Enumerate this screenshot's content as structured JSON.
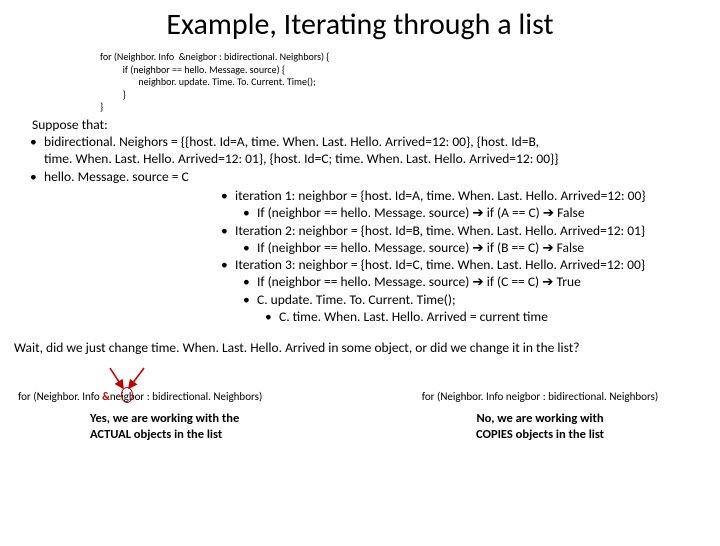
{
  "title": "Example, Iterating through a list",
  "code": {
    "l1": "for (Neighbor. Info  &neigbor : bidirectional. Neighbors) {",
    "l2": "          if (neighbor == hello. Message. source) {",
    "l3": "                 neighbor. update. Time. To. Current. Time();",
    "l4": "          }",
    "l5": "}"
  },
  "suppose": "Suppose that:",
  "assumptions": {
    "a1a": "bidirectional. Neighors = {{host. Id=A,  time. When. Last. Hello. Arrived=12: 00}, {host. Id=B,",
    "a1b": "time. When. Last. Hello. Arrived=12: 01}, {host. Id=C;  time. When. Last. Hello. Arrived=12: 00}}",
    "a2": "hello. Message. source = C"
  },
  "iter": {
    "i1": "iteration 1: neighbor = {host. Id=A,  time. When. Last. Hello. Arrived=12: 00}",
    "i1a": "If (neighbor == hello. Message. source)  ➔ if (A == C) ➔ False",
    "i2": "Iteration 2: neighbor = {host. Id=B,  time. When. Last. Hello. Arrived=12: 01}",
    "i2a": "If (neighbor == hello. Message. source)  ➔ if (B == C) ➔ False",
    "i3": "Iteration 3: neighbor = {host. Id=C,  time. When. Last. Hello. Arrived=12: 00}",
    "i3a": "If (neighbor == hello. Message. source)  ➔ if (C == C) ➔ True",
    "i3b": "C. update. Time. To. Current. Time();",
    "i3c": "C. time. When. Last. Hello. Arrived   = current time"
  },
  "question": "Wait, did we just change time. When. Last. Hello. Arrived  in some object, or did we change it in the list?",
  "left": {
    "for_pre": "for (Neighbor. Info ",
    "amp": "&",
    "for_post": "neigbor : bidirectional. Neighbors)",
    "cap1": "Yes, we are working with the",
    "cap2": "ACTUAL objects in the list"
  },
  "right": {
    "for": "for (Neighbor. Info neigbor : bidirectional. Neighbors)",
    "cap1": "No, we are working with",
    "cap2": "COPIES objects in the list"
  }
}
